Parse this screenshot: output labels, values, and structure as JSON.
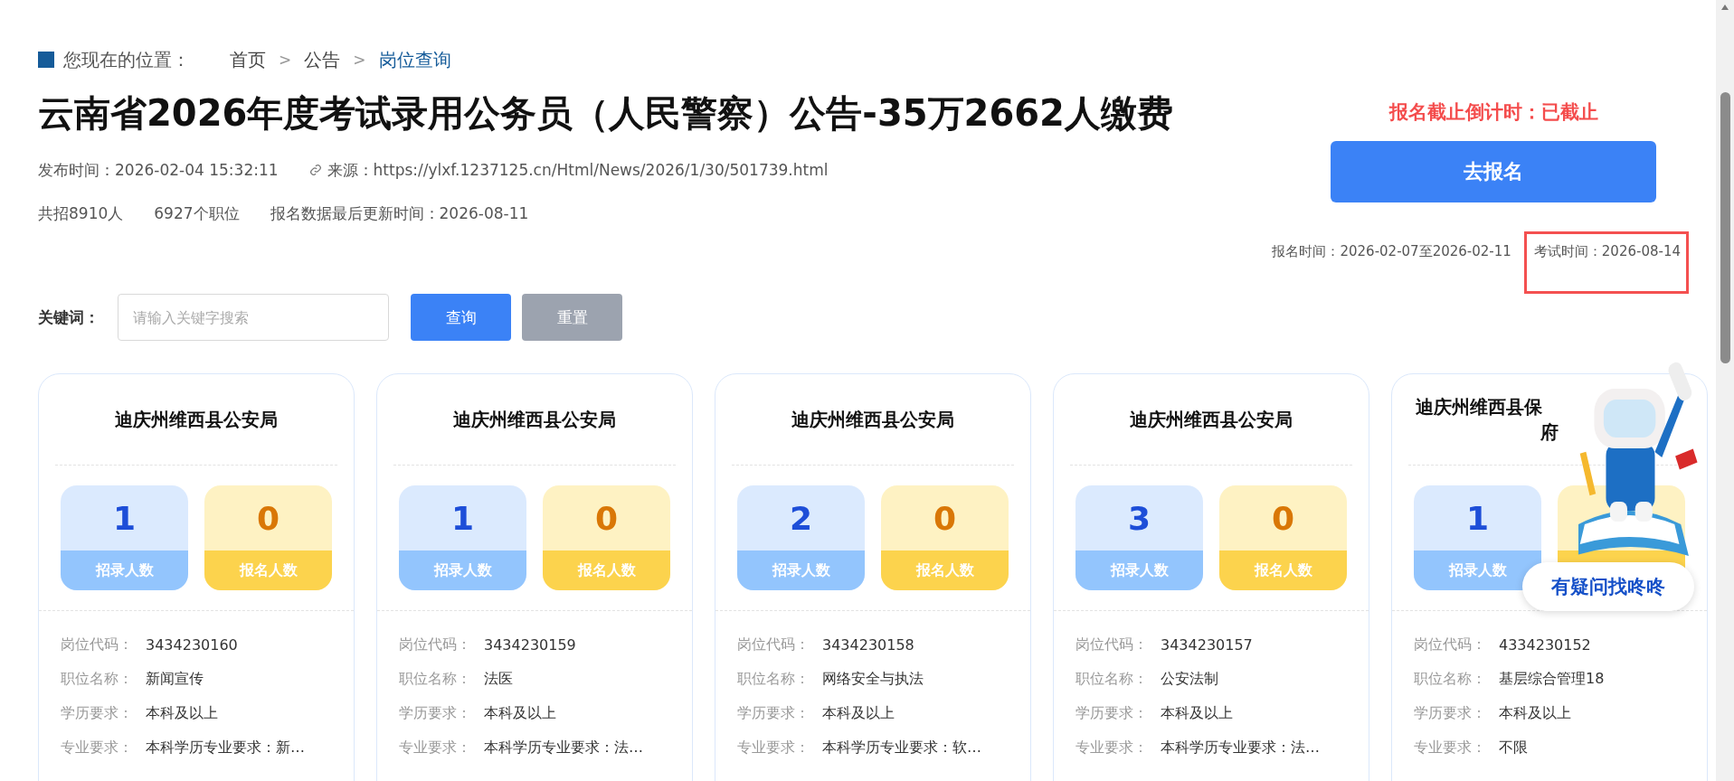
{
  "breadcrumb": {
    "label": "您现在的位置：",
    "items": [
      {
        "text": "首页",
        "selected": false
      },
      {
        "separator": ">",
        "text": "公告",
        "selected": false
      },
      {
        "separator": ">",
        "text": "岗位查询",
        "selected": true
      }
    ]
  },
  "title": "云南省2026年度考试录用公务员（人民警察）公告-35万2662人缴费",
  "meta": {
    "publish": "发布时间：2026-02-04 15:32:11",
    "source": "来源：https://ylxf.1237125.cn/Html/News/2026/1/30/501739.html"
  },
  "stats": [
    "共招8910人",
    "6927个职位",
    "报名数据最后更新时间：2026-08-11"
  ],
  "side": {
    "countdown": "报名截止倒计时：已截止",
    "button": "去报名",
    "signup_time": "报名时间：2026-02-07至2026-02-11",
    "exam_time": {
      "text": "考试时间：2026-08-14",
      "highlighted": true
    }
  },
  "search": {
    "label": "关键词：",
    "placeholder": "请输入关键字搜索",
    "buttons": [
      {
        "kind": "primary",
        "label": "查询"
      },
      {
        "kind": "secondary",
        "label": "重置"
      }
    ]
  },
  "cards": [
    {
      "title_lines": [
        "迪庆州维西县公安局"
      ],
      "hires": "1",
      "hires_label": "招录人数",
      "applicants": "0",
      "applicants_label": "报名人数",
      "details": [
        {
          "label": "岗位代码：",
          "value": "3434230160"
        },
        {
          "label": "职位名称：",
          "value": "新闻宣传"
        },
        {
          "label": "学历要求：",
          "value": "本科及以上"
        },
        {
          "label": "专业要求：",
          "value": "本科学历专业要求：新…"
        }
      ]
    },
    {
      "title_lines": [
        "迪庆州维西县公安局"
      ],
      "hires": "1",
      "hires_label": "招录人数",
      "applicants": "0",
      "applicants_label": "报名人数",
      "details": [
        {
          "label": "岗位代码：",
          "value": "3434230159"
        },
        {
          "label": "职位名称：",
          "value": "法医"
        },
        {
          "label": "学历要求：",
          "value": "本科及以上"
        },
        {
          "label": "专业要求：",
          "value": "本科学历专业要求：法…"
        }
      ]
    },
    {
      "title_lines": [
        "迪庆州维西县公安局"
      ],
      "hires": "2",
      "hires_label": "招录人数",
      "applicants": "0",
      "applicants_label": "报名人数",
      "details": [
        {
          "label": "岗位代码：",
          "value": "3434230158"
        },
        {
          "label": "职位名称：",
          "value": "网络安全与执法"
        },
        {
          "label": "学历要求：",
          "value": "本科及以上"
        },
        {
          "label": "专业要求：",
          "value": "本科学历专业要求：软…"
        }
      ]
    },
    {
      "title_lines": [
        "迪庆州维西县公安局"
      ],
      "hires": "3",
      "hires_label": "招录人数",
      "applicants": "0",
      "applicants_label": "报名人数",
      "details": [
        {
          "label": "岗位代码：",
          "value": "3434230157"
        },
        {
          "label": "职位名称：",
          "value": "公安法制"
        },
        {
          "label": "学历要求：",
          "value": "本科及以上"
        },
        {
          "label": "专业要求：",
          "value": "本科学历专业要求：法…"
        }
      ]
    },
    {
      "title_lines": [
        "迪庆州维西县保",
        "府"
      ],
      "hires": "1",
      "hires_label": "招录人数",
      "details": [
        {
          "label": "岗位代码：",
          "value": "4334230152"
        },
        {
          "label": "职位名称：",
          "value": "基层综合管理18"
        },
        {
          "label": "学历要求：",
          "value": "本科及以上"
        },
        {
          "label": "专业要求：",
          "value": "不限"
        }
      ]
    }
  ],
  "help_button": "有疑问找咚咚"
}
